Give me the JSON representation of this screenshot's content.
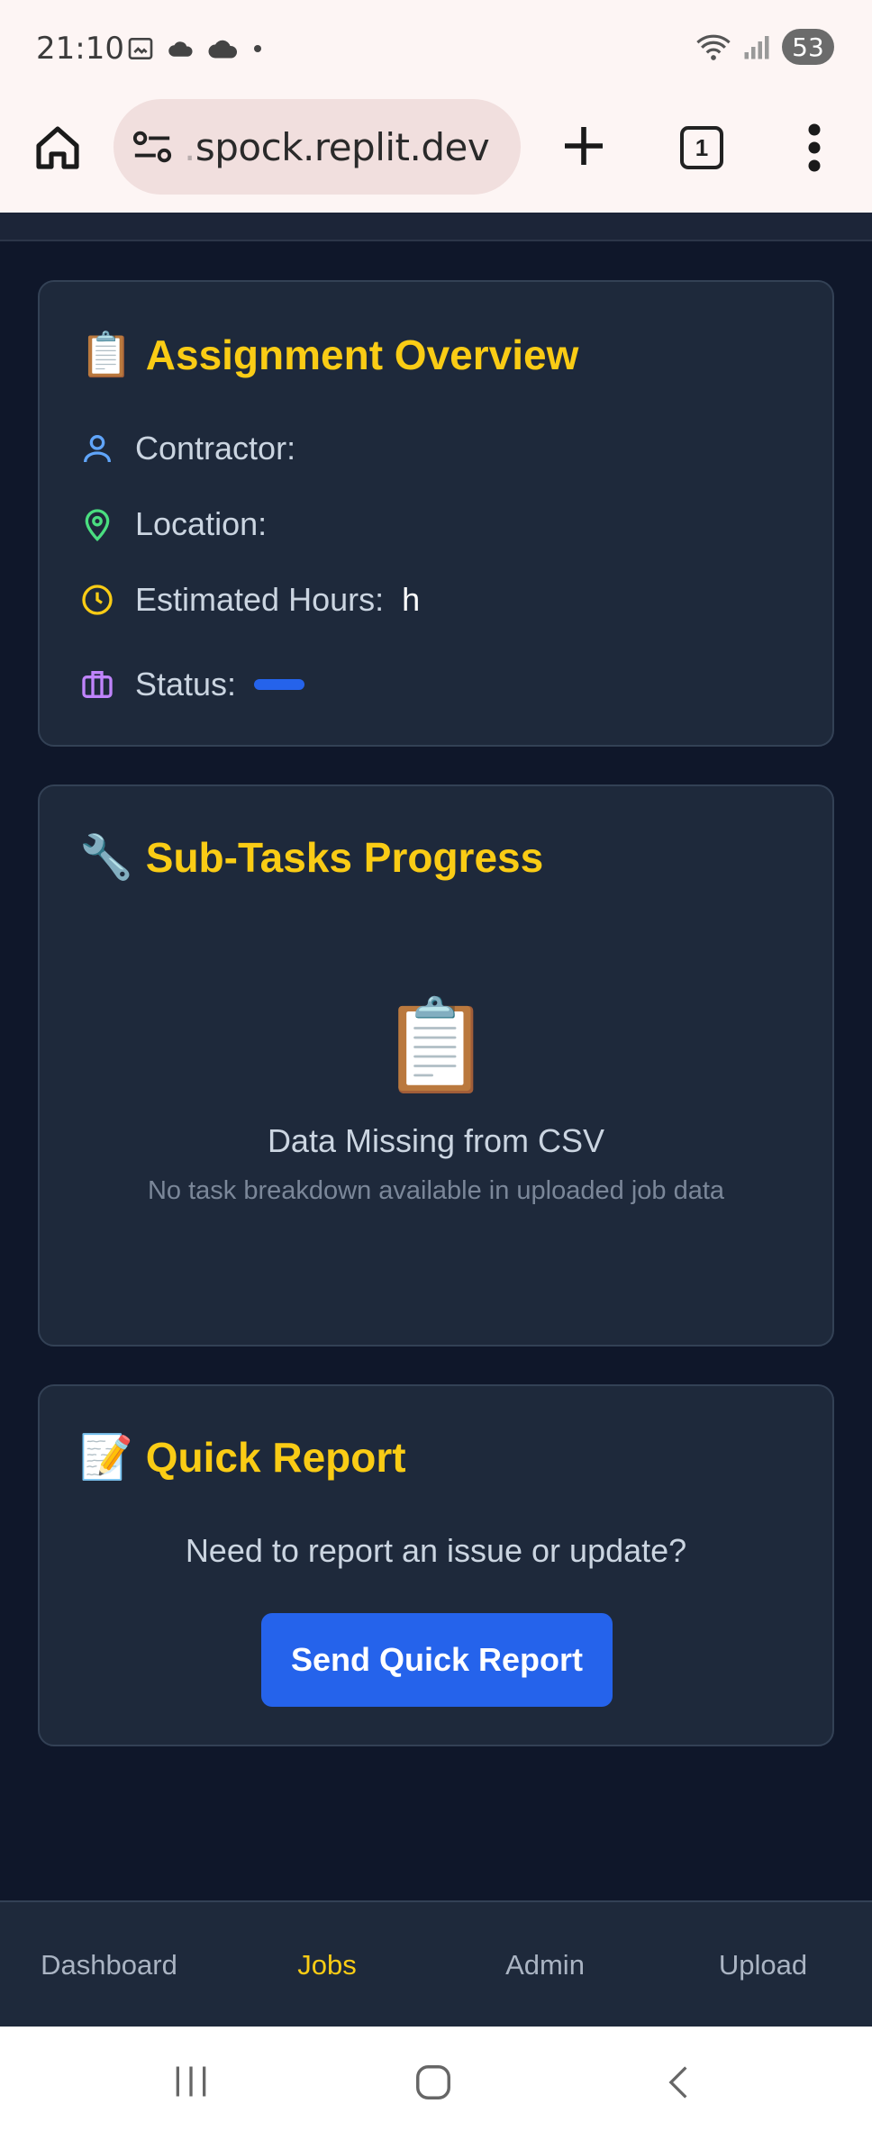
{
  "status_bar": {
    "time": "21:10",
    "battery": "53"
  },
  "browser": {
    "url_prefix": ".",
    "url_main": "spock.replit.dev",
    "tab_count": "1"
  },
  "assignment_overview": {
    "emoji": "📋",
    "title": "Assignment Overview",
    "contractor_label": "Contractor:",
    "location_label": "Location:",
    "hours_label": "Estimated Hours:",
    "hours_value": "h",
    "status_label": "Status:",
    "status_color": "#2563eb"
  },
  "subtasks": {
    "emoji": "🔧",
    "title": "Sub-Tasks Progress",
    "empty_emoji": "📋",
    "empty_title": "Data Missing from CSV",
    "empty_subtitle": "No task breakdown available in uploaded job data"
  },
  "quick_report": {
    "emoji": "📝",
    "title": "Quick Report",
    "prompt": "Need to report an issue or update?",
    "button_label": "Send Quick Report"
  },
  "bottom_nav": {
    "items": [
      "Dashboard",
      "Jobs",
      "Admin",
      "Upload"
    ],
    "active": "Jobs"
  },
  "colors": {
    "background": "#0f172a",
    "card": "#1e293b",
    "accent_yellow": "#facc15",
    "accent_blue": "#2563eb"
  }
}
